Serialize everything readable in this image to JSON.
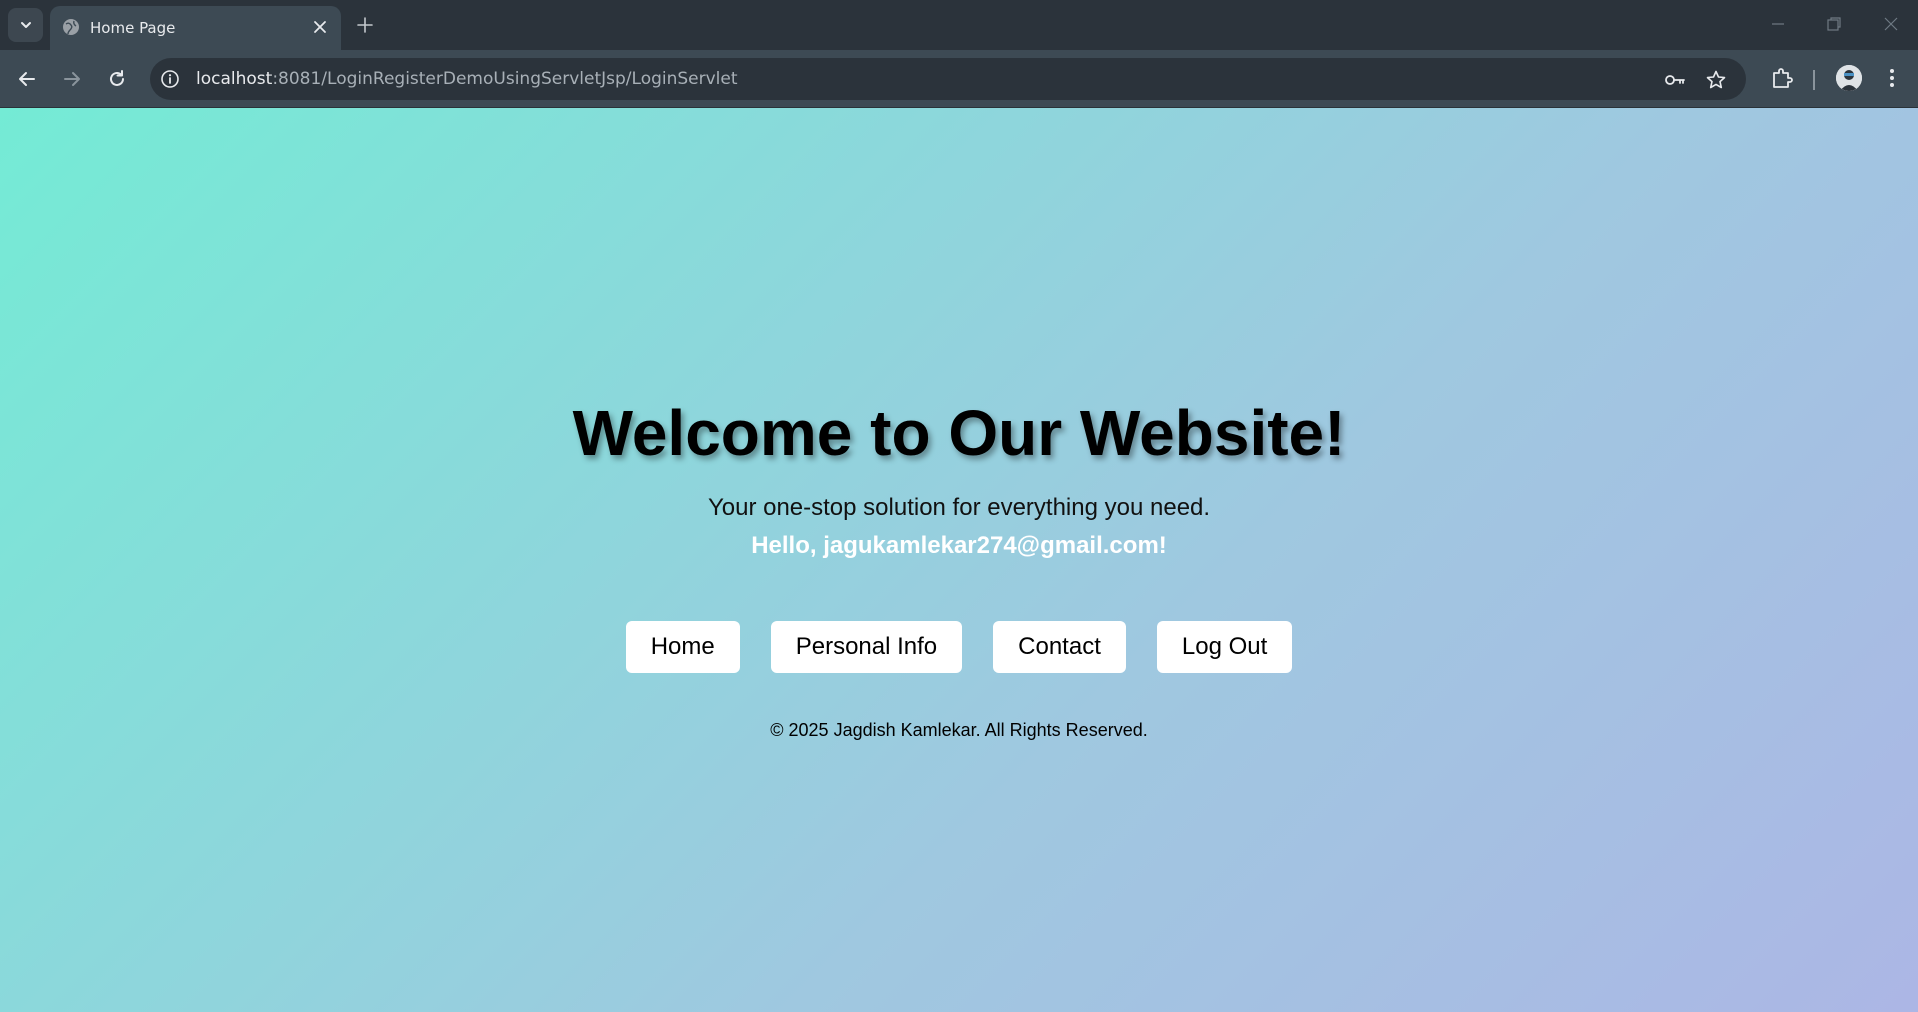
{
  "browser": {
    "tab": {
      "title": "Home Page"
    },
    "address_bar": {
      "host": "localhost",
      "path": ":8081/LoginRegisterDemoUsingServletJsp/LoginServlet"
    }
  },
  "page": {
    "heading": "Welcome to Our Website!",
    "tagline": "Your one-stop solution for everything you need.",
    "greeting": "Hello, jagukamlekar274@gmail.com!",
    "buttons": [
      "Home",
      "Personal Info",
      "Contact",
      "Log Out"
    ],
    "footer": "© 2025 Jagdish Kamlekar. All Rights Reserved."
  },
  "colors": {
    "gradient_start": "#74ebd5",
    "gradient_end": "#acb6e5",
    "greeting_text": "#ffffff",
    "button_bg": "#ffffff"
  }
}
